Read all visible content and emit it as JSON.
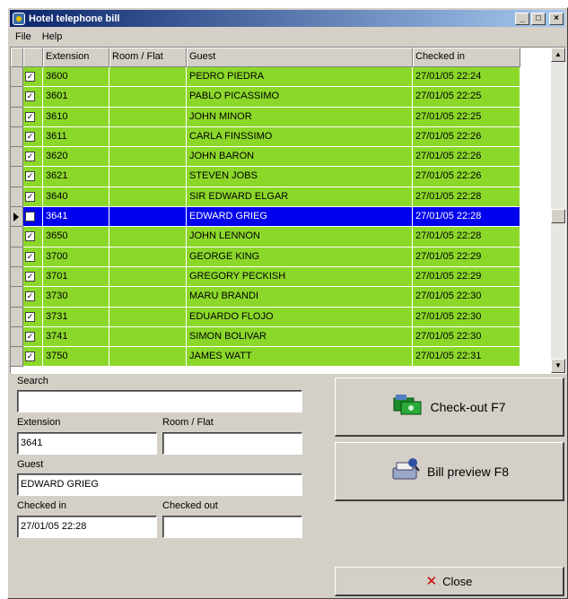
{
  "window": {
    "title": "Hotel telephone bill"
  },
  "menu": [
    "File",
    "Help"
  ],
  "grid": {
    "columns": [
      "Extension",
      "Room / Flat",
      "Guest",
      "Checked in"
    ],
    "rows": [
      {
        "checked": true,
        "extension": "3600",
        "room": "",
        "guest": "PEDRO PIEDRA",
        "checked_in": "27/01/05 22:24"
      },
      {
        "checked": true,
        "extension": "3601",
        "room": "",
        "guest": "PABLO PICASSIMO",
        "checked_in": "27/01/05 22:25"
      },
      {
        "checked": true,
        "extension": "3610",
        "room": "",
        "guest": "JOHN MINOR",
        "checked_in": "27/01/05 22:25"
      },
      {
        "checked": true,
        "extension": "3611",
        "room": "",
        "guest": "CARLA FINSSIMO",
        "checked_in": "27/01/05 22:26"
      },
      {
        "checked": true,
        "extension": "3620",
        "room": "",
        "guest": "JOHN BARON",
        "checked_in": "27/01/05 22:26"
      },
      {
        "checked": true,
        "extension": "3621",
        "room": "",
        "guest": "STEVEN JOBS",
        "checked_in": "27/01/05 22:26"
      },
      {
        "checked": true,
        "extension": "3640",
        "room": "",
        "guest": "SIR EDWARD ELGAR",
        "checked_in": "27/01/05 22:28"
      },
      {
        "checked": true,
        "extension": "3641",
        "room": "",
        "guest": "EDWARD GRIEG",
        "checked_in": "27/01/05 22:28",
        "selected": true
      },
      {
        "checked": true,
        "extension": "3650",
        "room": "",
        "guest": "JOHN LENNON",
        "checked_in": "27/01/05 22:28"
      },
      {
        "checked": true,
        "extension": "3700",
        "room": "",
        "guest": "GEORGE KING",
        "checked_in": "27/01/05 22:29"
      },
      {
        "checked": true,
        "extension": "3701",
        "room": "",
        "guest": "GREGORY PECKISH",
        "checked_in": "27/01/05 22:29"
      },
      {
        "checked": true,
        "extension": "3730",
        "room": "",
        "guest": "MARU BRANDI",
        "checked_in": "27/01/05 22:30"
      },
      {
        "checked": true,
        "extension": "3731",
        "room": "",
        "guest": "EDUARDO FLOJO",
        "checked_in": "27/01/05 22:30"
      },
      {
        "checked": true,
        "extension": "3741",
        "room": "",
        "guest": "SIMON BOLIVAR",
        "checked_in": "27/01/05 22:30"
      },
      {
        "checked": true,
        "extension": "3750",
        "room": "",
        "guest": "JAMES WATT",
        "checked_in": "27/01/05 22:31"
      }
    ]
  },
  "form": {
    "search_label": "Search",
    "search_value": "",
    "extension_label": "Extension",
    "extension_value": "3641",
    "room_label": "Room / Flat",
    "room_value": "",
    "guest_label": "Guest",
    "guest_value": "EDWARD GRIEG",
    "checked_in_label": "Checked in",
    "checked_in_value": "27/01/05 22:28",
    "checked_out_label": "Checked out",
    "checked_out_value": ""
  },
  "buttons": {
    "checkout": "Check-out F7",
    "bill_preview": "Bill preview F8",
    "close": "Close"
  },
  "colors": {
    "row_bg": "#8cd82a",
    "selected_bg": "#0000ee",
    "close_icon": "#cc0000"
  }
}
